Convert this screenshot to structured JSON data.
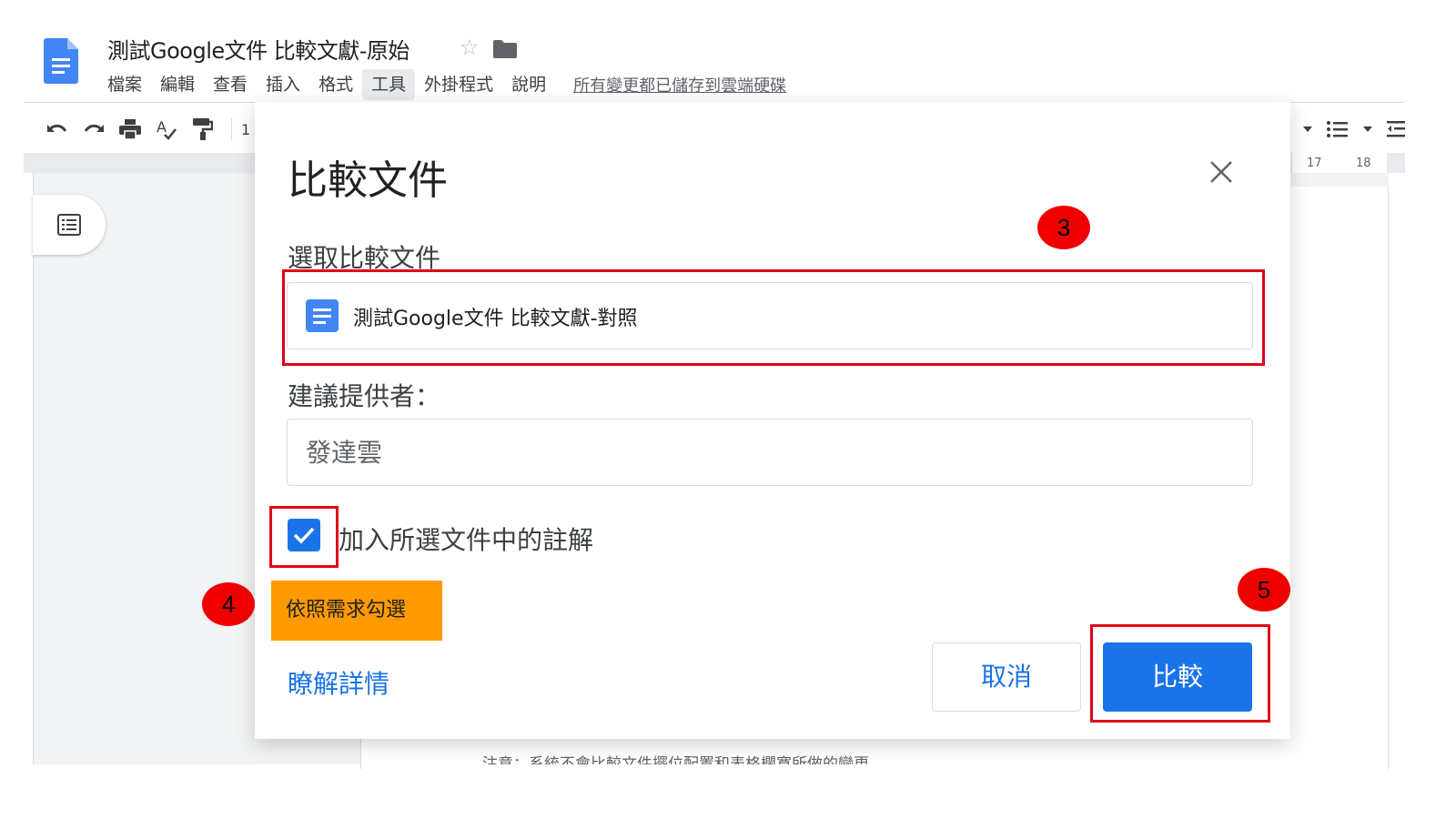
{
  "doc": {
    "title": "測試Google文件 比較文獻-原始",
    "save_status": "所有變更都已儲存到雲端硬碟"
  },
  "menu": {
    "items": [
      "檔案",
      "編輯",
      "查看",
      "插入",
      "格式",
      "工具",
      "外掛程式",
      "說明"
    ],
    "active_index": 5
  },
  "toolbar": {
    "icons": [
      "undo-icon",
      "redo-icon",
      "print-icon",
      "spellcheck-icon",
      "paint-format-icon"
    ],
    "zoom_partial": "1"
  },
  "ruler": {
    "ticks": [
      "17",
      "18"
    ]
  },
  "dialog": {
    "title": "比較文件",
    "select_label": "選取比較文件",
    "selected_doc": "測試Google文件 比較文獻-對照",
    "suggester_label": "建議提供者：",
    "suggester_value": "發達雲",
    "include_comments_label": "加入所選文件中的註解",
    "include_comments_checked": true,
    "learn_more": "瞭解詳情",
    "cancel_label": "取消",
    "compare_label": "比較"
  },
  "annotations": {
    "badge_3": "3",
    "badge_4": "4",
    "badge_5": "5",
    "note": "依照需求勾選",
    "box_color": "#e0001a",
    "badge_color": "#ee0000",
    "note_color": "#ff9900"
  },
  "colors": {
    "accent": "#1a73e8",
    "doc_blue": "#4285f4"
  },
  "bottom_note": "注意：系統不會比較文件擺位配置和表格欄寬所做的變更"
}
